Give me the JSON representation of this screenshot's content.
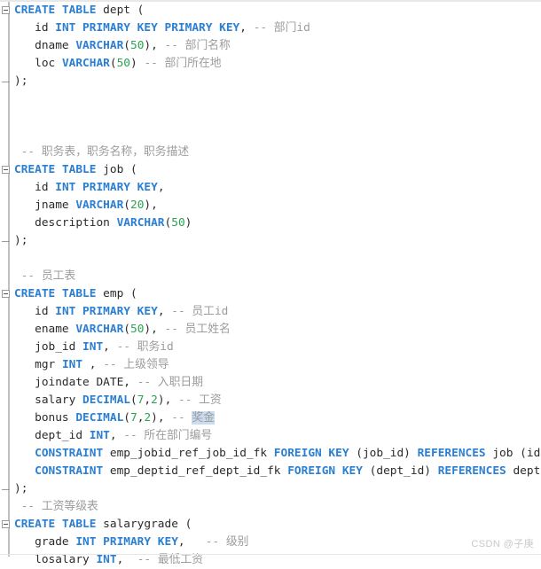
{
  "editor": {
    "language": "sql",
    "colors": {
      "background": "#ffffff",
      "keyword": "#2b7fd3",
      "number": "#2aa44f",
      "comment": "#9c9c9c",
      "text": "#2b2b2b",
      "selection": "#cadcef",
      "gutter_rail": "#bfbfbf"
    }
  },
  "watermark": {
    "text": "CSDN @子庚"
  },
  "lines": [
    {
      "n": 1,
      "fold": "start",
      "tokens": [
        {
          "t": "CREATE TABLE",
          "c": "kw"
        },
        {
          "t": " dept (",
          "c": "plain"
        }
      ]
    },
    {
      "n": 2,
      "fold": "",
      "tokens": [
        {
          "t": "   id ",
          "c": "plain"
        },
        {
          "t": "INT PRIMARY KEY PRIMARY KEY",
          "c": "kw"
        },
        {
          "t": ", ",
          "c": "plain"
        },
        {
          "t": "-- 部门id",
          "c": "cmt"
        }
      ]
    },
    {
      "n": 3,
      "fold": "",
      "tokens": [
        {
          "t": "   dname ",
          "c": "plain"
        },
        {
          "t": "VARCHAR",
          "c": "kw"
        },
        {
          "t": "(",
          "c": "plain"
        },
        {
          "t": "50",
          "c": "num"
        },
        {
          "t": "), ",
          "c": "plain"
        },
        {
          "t": "-- 部门名称",
          "c": "cmt"
        }
      ]
    },
    {
      "n": 4,
      "fold": "",
      "tokens": [
        {
          "t": "   loc ",
          "c": "plain"
        },
        {
          "t": "VARCHAR",
          "c": "kw"
        },
        {
          "t": "(",
          "c": "plain"
        },
        {
          "t": "50",
          "c": "num"
        },
        {
          "t": ") ",
          "c": "plain"
        },
        {
          "t": "-- 部门所在地",
          "c": "cmt"
        }
      ]
    },
    {
      "n": 5,
      "fold": "end",
      "tokens": [
        {
          "t": ");",
          "c": "plain"
        }
      ]
    },
    {
      "n": 6,
      "fold": "",
      "tokens": [
        {
          "t": "",
          "c": "plain"
        }
      ]
    },
    {
      "n": 7,
      "fold": "",
      "tokens": [
        {
          "t": "",
          "c": "plain"
        }
      ]
    },
    {
      "n": 8,
      "fold": "",
      "tokens": [
        {
          "t": "",
          "c": "plain"
        }
      ]
    },
    {
      "n": 9,
      "fold": "",
      "tokens": [
        {
          "t": " -- 职务表，职务名称，职务描述",
          "c": "cmt"
        }
      ]
    },
    {
      "n": 10,
      "fold": "start",
      "tokens": [
        {
          "t": "CREATE TABLE",
          "c": "kw"
        },
        {
          "t": " job (",
          "c": "plain"
        }
      ]
    },
    {
      "n": 11,
      "fold": "",
      "tokens": [
        {
          "t": "   id ",
          "c": "plain"
        },
        {
          "t": "INT PRIMARY KEY",
          "c": "kw"
        },
        {
          "t": ",",
          "c": "plain"
        }
      ]
    },
    {
      "n": 12,
      "fold": "",
      "tokens": [
        {
          "t": "   jname ",
          "c": "plain"
        },
        {
          "t": "VARCHAR",
          "c": "kw"
        },
        {
          "t": "(",
          "c": "plain"
        },
        {
          "t": "20",
          "c": "num"
        },
        {
          "t": "),",
          "c": "plain"
        }
      ]
    },
    {
      "n": 13,
      "fold": "",
      "tokens": [
        {
          "t": "   description ",
          "c": "plain"
        },
        {
          "t": "VARCHAR",
          "c": "kw"
        },
        {
          "t": "(",
          "c": "plain"
        },
        {
          "t": "50",
          "c": "num"
        },
        {
          "t": ")",
          "c": "plain"
        }
      ]
    },
    {
      "n": 14,
      "fold": "end",
      "tokens": [
        {
          "t": ");",
          "c": "plain"
        }
      ]
    },
    {
      "n": 15,
      "fold": "",
      "tokens": [
        {
          "t": "",
          "c": "plain"
        }
      ]
    },
    {
      "n": 16,
      "fold": "",
      "tokens": [
        {
          "t": " -- 员工表",
          "c": "cmt"
        }
      ]
    },
    {
      "n": 17,
      "fold": "start",
      "tokens": [
        {
          "t": "CREATE TABLE",
          "c": "kw"
        },
        {
          "t": " emp (",
          "c": "plain"
        }
      ]
    },
    {
      "n": 18,
      "fold": "",
      "tokens": [
        {
          "t": "   id ",
          "c": "plain"
        },
        {
          "t": "INT PRIMARY KEY",
          "c": "kw"
        },
        {
          "t": ", ",
          "c": "plain"
        },
        {
          "t": "-- 员工id",
          "c": "cmt"
        }
      ]
    },
    {
      "n": 19,
      "fold": "",
      "tokens": [
        {
          "t": "   ename ",
          "c": "plain"
        },
        {
          "t": "VARCHAR",
          "c": "kw"
        },
        {
          "t": "(",
          "c": "plain"
        },
        {
          "t": "50",
          "c": "num"
        },
        {
          "t": "), ",
          "c": "plain"
        },
        {
          "t": "-- 员工姓名",
          "c": "cmt"
        }
      ]
    },
    {
      "n": 20,
      "fold": "",
      "tokens": [
        {
          "t": "   job_id ",
          "c": "plain"
        },
        {
          "t": "INT",
          "c": "kw"
        },
        {
          "t": ", ",
          "c": "plain"
        },
        {
          "t": "-- 职务id",
          "c": "cmt"
        }
      ]
    },
    {
      "n": 21,
      "fold": "",
      "tokens": [
        {
          "t": "   mgr ",
          "c": "plain"
        },
        {
          "t": "INT",
          "c": "kw"
        },
        {
          "t": " , ",
          "c": "plain"
        },
        {
          "t": "-- 上级领导",
          "c": "cmt"
        }
      ]
    },
    {
      "n": 22,
      "fold": "",
      "tokens": [
        {
          "t": "   joindate DATE, ",
          "c": "plain"
        },
        {
          "t": "-- 入职日期",
          "c": "cmt"
        }
      ]
    },
    {
      "n": 23,
      "fold": "",
      "tokens": [
        {
          "t": "   salary ",
          "c": "plain"
        },
        {
          "t": "DECIMAL",
          "c": "kw"
        },
        {
          "t": "(",
          "c": "plain"
        },
        {
          "t": "7",
          "c": "num"
        },
        {
          "t": ",",
          "c": "plain"
        },
        {
          "t": "2",
          "c": "num"
        },
        {
          "t": "), ",
          "c": "plain"
        },
        {
          "t": "-- 工资",
          "c": "cmt"
        }
      ]
    },
    {
      "n": 24,
      "fold": "",
      "tokens": [
        {
          "t": "   bonus ",
          "c": "plain"
        },
        {
          "t": "DECIMAL",
          "c": "kw"
        },
        {
          "t": "(",
          "c": "plain"
        },
        {
          "t": "7",
          "c": "num"
        },
        {
          "t": ",",
          "c": "plain"
        },
        {
          "t": "2",
          "c": "num"
        },
        {
          "t": "), ",
          "c": "plain"
        },
        {
          "t": "-- ",
          "c": "cmt"
        },
        {
          "t": "奖金",
          "c": "cmt sel"
        }
      ]
    },
    {
      "n": 25,
      "fold": "",
      "tokens": [
        {
          "t": "   dept_id ",
          "c": "plain"
        },
        {
          "t": "INT",
          "c": "kw"
        },
        {
          "t": ", ",
          "c": "plain"
        },
        {
          "t": "-- 所在部门编号",
          "c": "cmt"
        }
      ]
    },
    {
      "n": 26,
      "fold": "",
      "tokens": [
        {
          "t": "   ",
          "c": "plain"
        },
        {
          "t": "CONSTRAINT",
          "c": "kw"
        },
        {
          "t": " emp_jobid_ref_job_id_fk ",
          "c": "plain"
        },
        {
          "t": "FOREIGN KEY",
          "c": "kw"
        },
        {
          "t": " (job_id) ",
          "c": "plain"
        },
        {
          "t": "REFERENCES",
          "c": "kw"
        },
        {
          "t": " job (id),",
          "c": "plain"
        }
      ]
    },
    {
      "n": 27,
      "fold": "",
      "tokens": [
        {
          "t": "   ",
          "c": "plain"
        },
        {
          "t": "CONSTRAINT",
          "c": "kw"
        },
        {
          "t": " emp_deptid_ref_dept_id_fk ",
          "c": "plain"
        },
        {
          "t": "FOREIGN KEY",
          "c": "kw"
        },
        {
          "t": " (dept_id) ",
          "c": "plain"
        },
        {
          "t": "REFERENCES",
          "c": "kw"
        },
        {
          "t": " dept (id)",
          "c": "plain"
        }
      ]
    },
    {
      "n": 28,
      "fold": "end",
      "tokens": [
        {
          "t": ");",
          "c": "plain"
        }
      ]
    },
    {
      "n": 29,
      "fold": "",
      "tokens": [
        {
          "t": " -- 工资等级表",
          "c": "cmt"
        }
      ]
    },
    {
      "n": 30,
      "fold": "start",
      "tokens": [
        {
          "t": "CREATE TABLE",
          "c": "kw"
        },
        {
          "t": " salarygrade (",
          "c": "plain"
        }
      ]
    },
    {
      "n": 31,
      "fold": "",
      "tokens": [
        {
          "t": "   grade ",
          "c": "plain"
        },
        {
          "t": "INT PRIMARY KEY",
          "c": "kw"
        },
        {
          "t": ",   ",
          "c": "plain"
        },
        {
          "t": "-- 级别",
          "c": "cmt"
        }
      ]
    },
    {
      "n": 32,
      "fold": "",
      "tokens": [
        {
          "t": "   losalary ",
          "c": "plain"
        },
        {
          "t": "INT",
          "c": "kw"
        },
        {
          "t": ",  ",
          "c": "plain"
        },
        {
          "t": "-- 最低工资",
          "c": "cmt"
        }
      ]
    }
  ]
}
